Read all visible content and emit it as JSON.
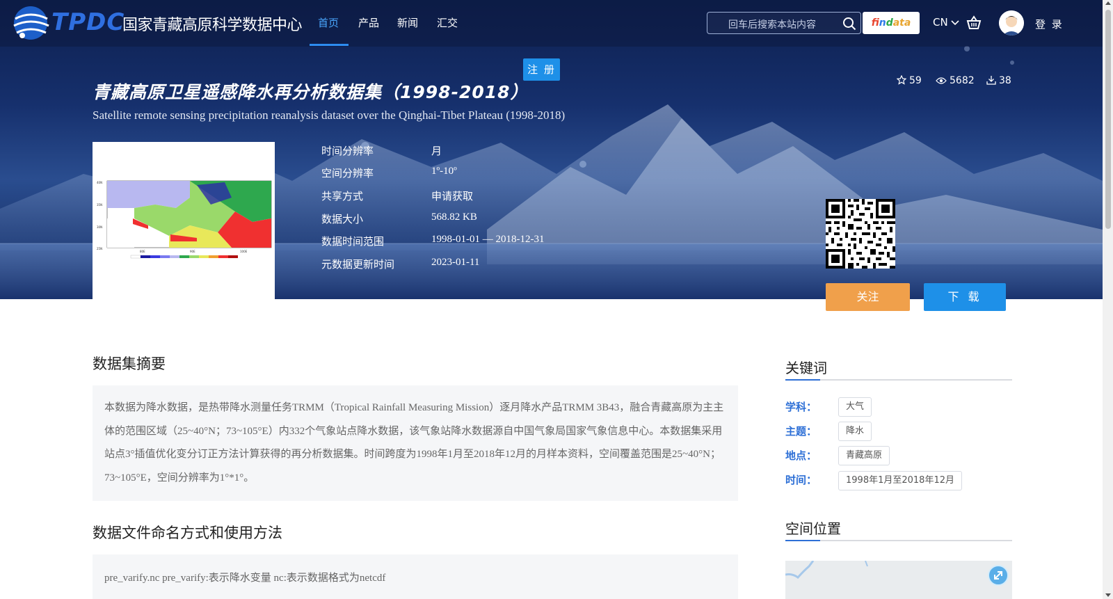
{
  "brand": {
    "logo_abbr": "TPDC",
    "logo_name": "国家青藏高原科学数据中心"
  },
  "nav": {
    "items": [
      {
        "label": "首页",
        "active": true
      },
      {
        "label": "产品",
        "active": false
      },
      {
        "label": "新闻",
        "active": false
      },
      {
        "label": "汇交",
        "active": false
      }
    ]
  },
  "header": {
    "search_placeholder": "回车后搜索本站内容",
    "findata_label": [
      "f",
      "in",
      "d",
      "ata"
    ],
    "lang": "CN",
    "login_label": "登 录",
    "register_label": "注 册"
  },
  "dataset": {
    "title": "青藏高原卫星遥感降水再分析数据集（1998-2018）",
    "subtitle": "Satellite remote sensing precipitation reanalysis dataset over the Qinghai-Tibet Plateau (1998-2018)",
    "stats": {
      "favorites": "59",
      "views": "5682",
      "downloads": "38"
    },
    "meta": [
      {
        "label": "时间分辨率",
        "value": "月"
      },
      {
        "label": "空间分辨率",
        "value": "1º-10º"
      },
      {
        "label": "共享方式",
        "value": "申请获取"
      },
      {
        "label": "数据大小",
        "value": "568.82 KB"
      },
      {
        "label": "数据时间范围",
        "value": "1998-01-01 — 2018-12-31"
      },
      {
        "label": "元数据更新时间",
        "value": "2023-01-11"
      }
    ],
    "follow_label": "关注",
    "download_label": "下 载"
  },
  "thumbnail": {
    "lat_labels": [
      "40N",
      "35N",
      "30N",
      "25N"
    ],
    "lon_labels": [
      "80E",
      "90E",
      "100E"
    ]
  },
  "main": {
    "abstract_title": "数据集摘要",
    "abstract_text": "本数据为降水数据，是热带降水测量任务TRMM（Tropical Rainfall Measuring Mission）逐月降水产品TRMM 3B43，融合青藏高原为主主体的范围区域（25~40°N；73~105°E）内332个气象站点降水数据，该气象站降水数据源自中国气象局国家气象信息中心。本数据集采用站点3°插值优化变分订正方法计算获得的再分析数据集。时间跨度为1998年1月至2018年12月的月样本资料，空间覆盖范围是25~40°N；73~105°E，空间分辨率为1°*1°。",
    "usage_title": "数据文件命名方式和使用方法",
    "usage_text": "pre_varify.nc pre_varify:表示降水变量 nc:表示数据格式为netcdf"
  },
  "sidebar": {
    "keywords_title": "关键词",
    "keywords": [
      {
        "label": "学科：",
        "tag": "大气"
      },
      {
        "label": "主题：",
        "tag": "降水"
      },
      {
        "label": "地点：",
        "tag": "青藏高原"
      },
      {
        "label": "时间：",
        "tag": "1998年1月至2018年12月"
      }
    ],
    "location_title": "空间位置"
  },
  "colors": {
    "accent": "#1e90e8",
    "follow": "#f0a04b",
    "nav_active": "#4aa8ff",
    "keyword_label": "#2d6fd6"
  }
}
